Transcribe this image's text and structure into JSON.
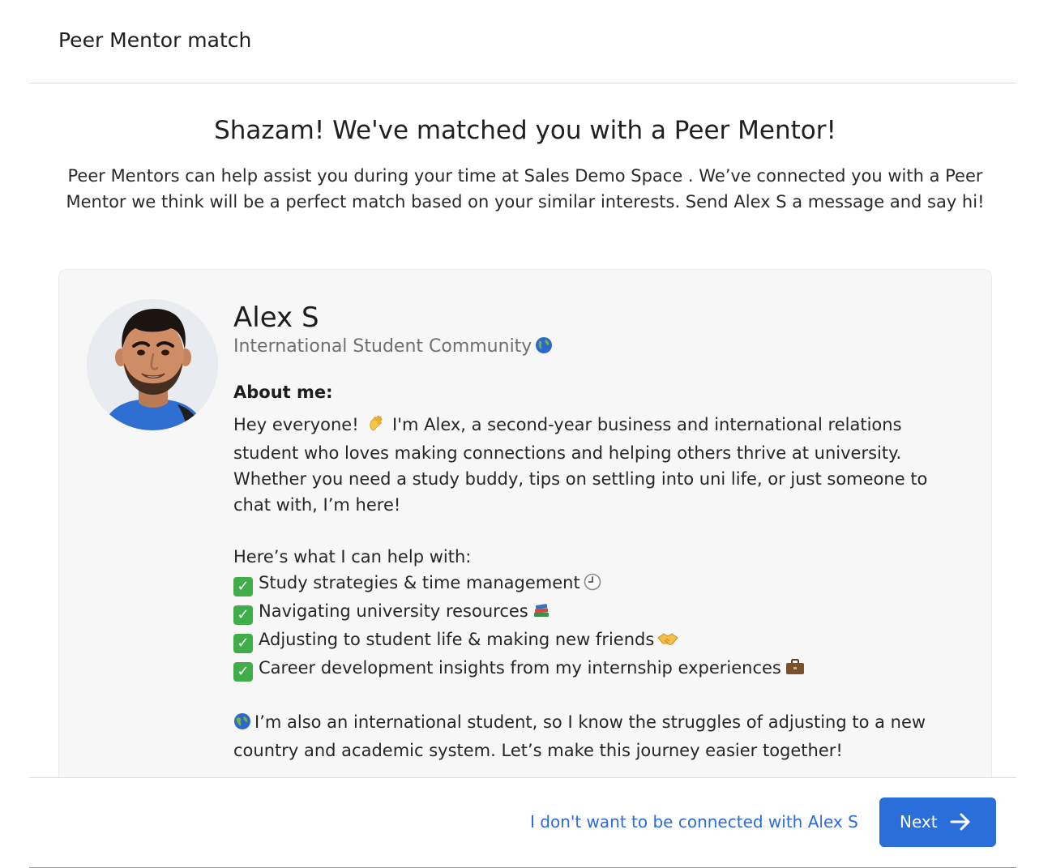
{
  "header": {
    "title": "Peer Mentor match"
  },
  "main": {
    "headline": "Shazam! We've matched you with a Peer Mentor!",
    "intro": "Peer Mentors can help assist you during your time at Sales Demo Space . We’ve connected you with a Peer Mentor we think will be a perfect match based on your similar interests. Send Alex S a message and say hi!"
  },
  "mentor": {
    "name": "Alex S",
    "community": "International Student Community",
    "community_icon": "globe-icon",
    "about_label": "About me:",
    "bio_intro_before_emoji": "Hey everyone!",
    "bio_intro_after_emoji": "I'm Alex, a second-year business and international relations student who loves making connections and helping others thrive at university. Whether you need a study buddy, tips on settling into uni life, or just someone to chat with, I’m here!",
    "help_heading": "Here’s what I can help with:",
    "help_items": [
      {
        "text": "Study strategies & time management",
        "icon": "clock-icon"
      },
      {
        "text": "Navigating university resources",
        "icon": "books-icon"
      },
      {
        "text": "Adjusting to student life & making new friends",
        "icon": "handshake-icon"
      },
      {
        "text": "Career development insights from my internship experiences",
        "icon": "briefcase-icon"
      }
    ],
    "closing": "I’m also an international student, so I know the struggles of adjusting to a new country and academic system. Let’s make this journey easier together!"
  },
  "footer": {
    "decline_label": "I don't want to be connected with Alex S",
    "next_label": "Next"
  },
  "colors": {
    "accent": "#2a6fd9",
    "link": "#2d6bd8",
    "check": "#3fae49",
    "card_bg": "#f7f7f7"
  }
}
